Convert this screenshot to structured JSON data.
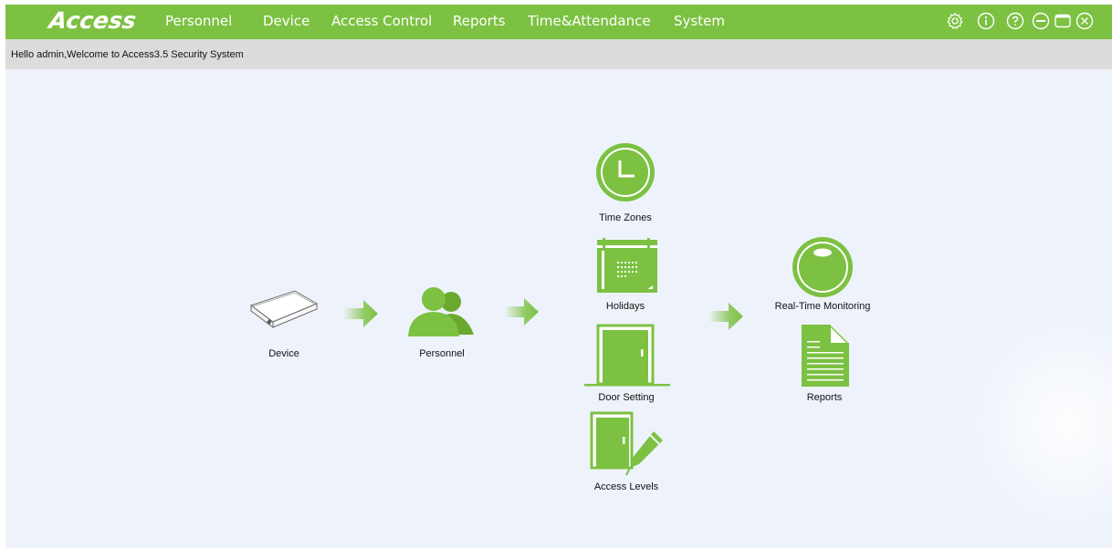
{
  "app": {
    "logo": "Access",
    "accent_color": "#7cc142",
    "background_color": "#eef3fb"
  },
  "menu": [
    {
      "label": "Personnel"
    },
    {
      "label": "Device"
    },
    {
      "label": "Access Control"
    },
    {
      "label": "Reports"
    },
    {
      "label": "Time&Attendance"
    },
    {
      "label": "System"
    }
  ],
  "window_controls": [
    {
      "icon": "gear-icon"
    },
    {
      "icon": "info-icon"
    },
    {
      "icon": "help-icon"
    },
    {
      "icon": "minimize-icon"
    },
    {
      "icon": "maximize-icon"
    },
    {
      "icon": "close-icon"
    }
  ],
  "welcome": "Hello admin,Welcome to Access3.5 Security System",
  "flow": {
    "device": "Device",
    "personnel": "Personnel",
    "time_zones": "Time Zones",
    "holidays": "Holidays",
    "door_setting": "Door Setting",
    "access_levels": "Access Levels",
    "real_time_monitoring": "Real-Time Monitoring",
    "reports": "Reports"
  }
}
